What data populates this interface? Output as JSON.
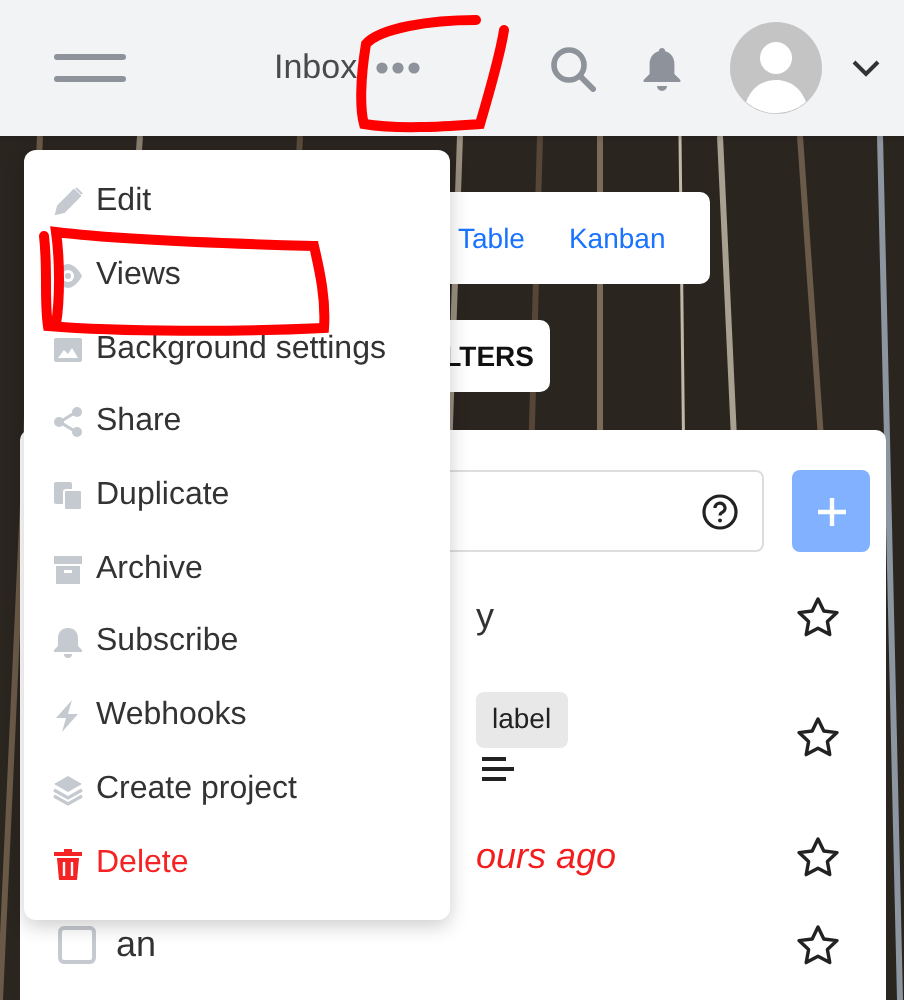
{
  "header": {
    "title": "Inbox"
  },
  "view_switcher": {
    "tabs": [
      {
        "label": "Table",
        "selected": false
      },
      {
        "label": "Kanban",
        "selected": false
      }
    ]
  },
  "filters_button": {
    "label": "LTERS"
  },
  "tasks": [
    {
      "title": "y",
      "favorite": false
    },
    {
      "labels": [
        "label"
      ],
      "has_description": true,
      "favorite": false
    },
    {
      "due": "ours ago",
      "overdue": true,
      "favorite": false
    },
    {
      "title": "an",
      "done": false,
      "favorite": false
    }
  ],
  "menu": {
    "items": [
      {
        "label": "Edit",
        "danger": false
      },
      {
        "label": "Views",
        "danger": false
      },
      {
        "label": "Background settings",
        "danger": false
      },
      {
        "label": "Share",
        "danger": false
      },
      {
        "label": "Duplicate",
        "danger": false
      },
      {
        "label": "Archive",
        "danger": false
      },
      {
        "label": "Subscribe",
        "danger": false
      },
      {
        "label": "Webhooks",
        "danger": false
      },
      {
        "label": "Create project",
        "danger": false
      },
      {
        "label": "Delete",
        "danger": true
      }
    ]
  }
}
